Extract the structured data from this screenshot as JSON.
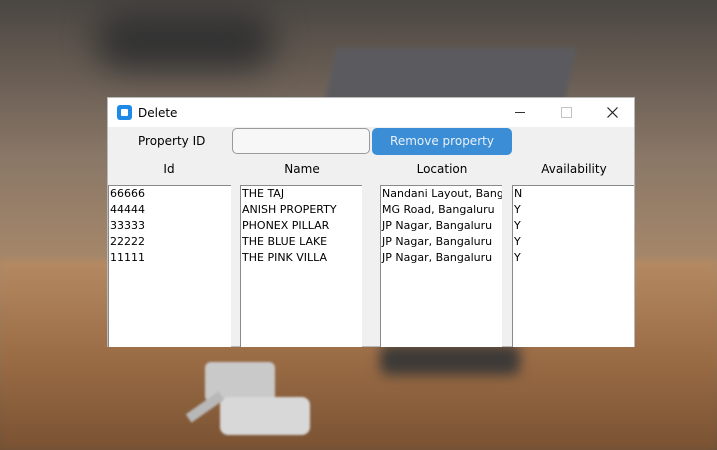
{
  "window": {
    "title": "Delete"
  },
  "form": {
    "property_id_label": "Property ID",
    "property_id_value": "",
    "remove_button_label": "Remove property"
  },
  "columns": {
    "id_header": "Id",
    "name_header": "Name",
    "location_header": "Location",
    "availability_header": "Availability"
  },
  "lists": {
    "ids": [
      "66666",
      "44444",
      "33333",
      "22222",
      "11111"
    ],
    "names": [
      "THE TAJ",
      "ANISH PROPERTY",
      "PHONEX PILLAR",
      "THE BLUE LAKE",
      "THE PINK VILLA"
    ],
    "locations": [
      "Nandani Layout, Banga",
      "MG Road, Bangaluru",
      "JP Nagar, Bangaluru",
      "JP Nagar, Bangaluru",
      "JP Nagar, Bangaluru"
    ],
    "availability": [
      "N",
      "Y",
      "Y",
      "Y",
      "Y"
    ]
  },
  "colors": {
    "accent": "#3b8ed6",
    "app_icon": "#1e8ae8"
  },
  "icons": {
    "app": "app-icon",
    "minimize": "minimize-icon",
    "maximize": "maximize-icon",
    "close": "close-icon"
  }
}
